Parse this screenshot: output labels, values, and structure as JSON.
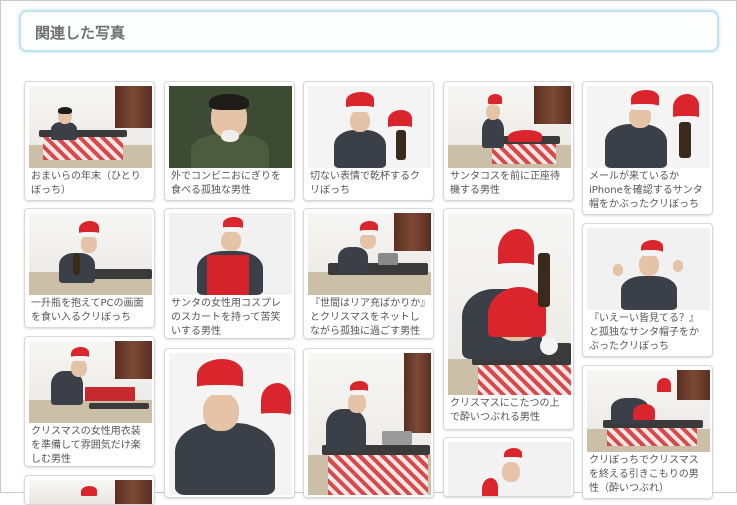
{
  "header": {
    "title": "関連した写真"
  },
  "photos": [
    {
      "caption": "おまいらの年末（ひとりぼっち）"
    },
    {
      "caption": "外でコンビニおにぎりを食べる孤独な男性"
    },
    {
      "caption": "切ない表情で乾杯するクリぼっち"
    },
    {
      "caption": "サンタコスを前に正座待機する男性"
    },
    {
      "caption": "メールが来ているかiPhoneを確認するサンタ帽をかぶったクリぼっち"
    },
    {
      "caption": "一升瓶を抱えてPCの画面を食い入るクリぼっち"
    },
    {
      "caption": "サンタの女性用コスプレのスカートを持って苦笑いする男性"
    },
    {
      "caption": "『世間はリア充ばかりか』とクリスマスをネットしながら孤独に過ごす男性"
    },
    {
      "caption": "クリスマスにこたつの上で酔いつぶれる男性"
    },
    {
      "caption": "『いえーい皆見てる？』と孤独なサンタ帽子をかぶったクリぼっち"
    },
    {
      "caption": "クリスマスの女性用衣装を準備して雰囲気だけ楽しむ男性"
    },
    {
      "caption": ""
    },
    {
      "caption": ""
    },
    {
      "caption": "クリぼっちでクリスマスを終える引きこもりの男性（酔いつぶれ）"
    },
    {
      "caption": ""
    },
    {
      "caption": ""
    },
    {
      "caption": ""
    }
  ]
}
